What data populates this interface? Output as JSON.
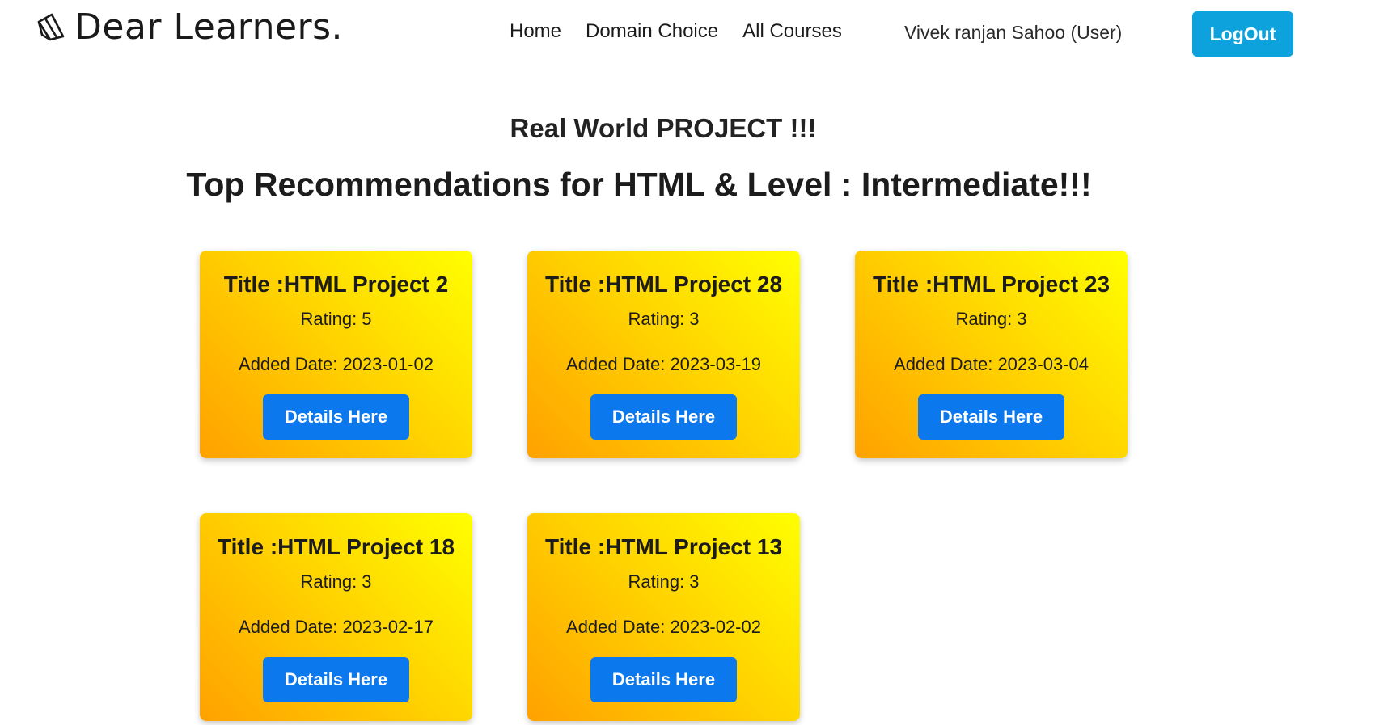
{
  "nav": {
    "brand": "Dear Learners.",
    "links": [
      "Home",
      "Domain Choice",
      "All Courses"
    ],
    "user": "Vivek ranjan Sahoo (User)",
    "logout": "LogOut"
  },
  "headings": {
    "section": "Real World PROJECT !!!",
    "recommendations": "Top Recommendations for HTML & Level : Intermediate!!!"
  },
  "cards": [
    {
      "title": "Title :HTML Project 2",
      "rating": "Rating: 5",
      "date": "Added Date: 2023-01-02",
      "button": "Details Here"
    },
    {
      "title": "Title :HTML Project 28",
      "rating": "Rating: 3",
      "date": "Added Date: 2023-03-19",
      "button": "Details Here"
    },
    {
      "title": "Title :HTML Project 23",
      "rating": "Rating: 3",
      "date": "Added Date: 2023-03-04",
      "button": "Details Here"
    },
    {
      "title": "Title :HTML Project 18",
      "rating": "Rating: 3",
      "date": "Added Date: 2023-02-17",
      "button": "Details Here"
    },
    {
      "title": "Title :HTML Project 13",
      "rating": "Rating: 3",
      "date": "Added Date: 2023-02-02",
      "button": "Details Here"
    }
  ],
  "colors": {
    "logout_bg": "#0ea2dc",
    "details_bg": "#0b78ee",
    "card_gradient": [
      "#ffa100",
      "#ffcc00",
      "#ffff00"
    ]
  },
  "icons": {
    "brand": "book-icon"
  }
}
